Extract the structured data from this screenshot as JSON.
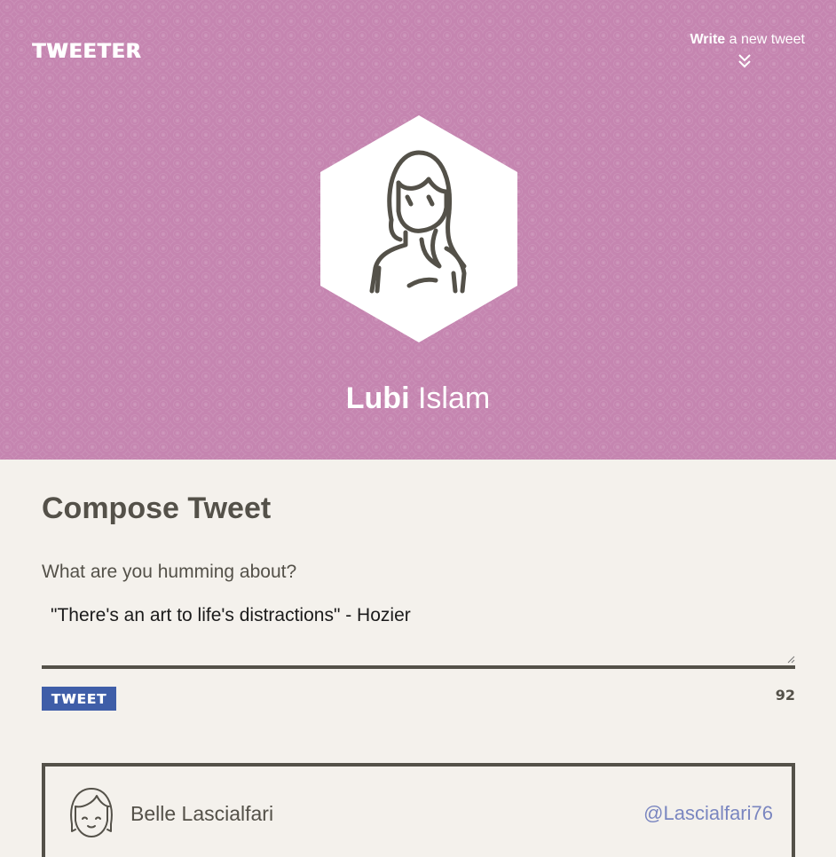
{
  "app": {
    "logo": "TWEETER"
  },
  "nav": {
    "write_bold": "Write",
    "write_rest": " a new tweet"
  },
  "profile": {
    "first_name": "Lubi",
    "last_name": "Islam"
  },
  "compose": {
    "title": "Compose Tweet",
    "label": "What are you humming about?",
    "value": "\"There's an art to life's distractions\" - Hozier",
    "button_label": "TWEET",
    "counter": "92"
  },
  "tweets": [
    {
      "name": "Belle Lascialfari",
      "handle": "@Lascialfari76"
    }
  ],
  "colors": {
    "header_bg": "#c585b0",
    "page_bg": "#f4f1ec",
    "text": "#545149",
    "button": "#3f5ea8",
    "handle": "#7a86c0"
  }
}
